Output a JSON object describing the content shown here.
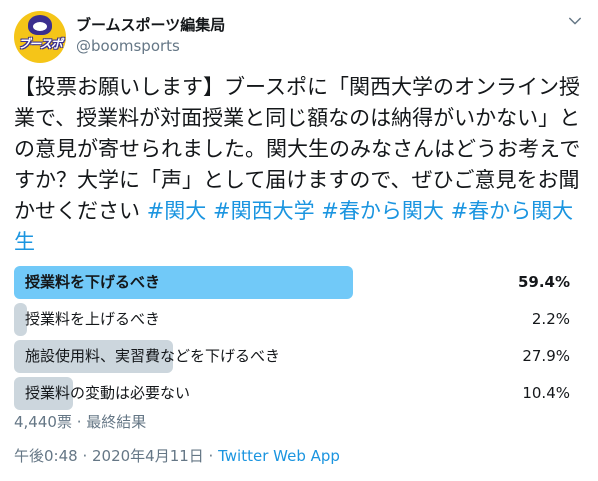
{
  "author": {
    "name": "ブームスポーツ編集局",
    "handle": "@boomsports",
    "avatar_text": "ブースポ",
    "avatar_color": "#f5c518"
  },
  "tweet": {
    "text": "【投票お願いします】ブースポに「関西大学のオンライン授業で、授業料が対面授業と同じ額なのは納得がいかない」との意見が寄せられました。関大生のみなさんはどうお考えですか？大学に「声」として届けますので、ぜひご意見をお聞かせください",
    "hashtags": [
      "#関大",
      "#関西大学",
      "#春から関大",
      "#春から関大生"
    ]
  },
  "poll": {
    "options": [
      {
        "label": "授業料を下げるべき",
        "percent": "59.4%",
        "fill": 0.594,
        "winner": true
      },
      {
        "label": "授業料を上げるべき",
        "percent": "2.2%",
        "fill": 0.022,
        "winner": false
      },
      {
        "label": "施設使用料、実習費などを下げるべき",
        "percent": "27.9%",
        "fill": 0.279,
        "winner": false
      },
      {
        "label": "授業料の変動は必要ない",
        "percent": "10.4%",
        "fill": 0.104,
        "winner": false
      }
    ],
    "summary": "4,440票 · 最終結果"
  },
  "footer": {
    "timestamp": "午後0:48 · 2020年4月11日 · ",
    "source": "Twitter Web App"
  },
  "colors": {
    "accent": "#1b95e0",
    "winner_bar": "#71c9f8",
    "bar": "#ccd6dd",
    "muted": "#657786"
  },
  "icons": {
    "menu": "chevron-down-icon"
  }
}
